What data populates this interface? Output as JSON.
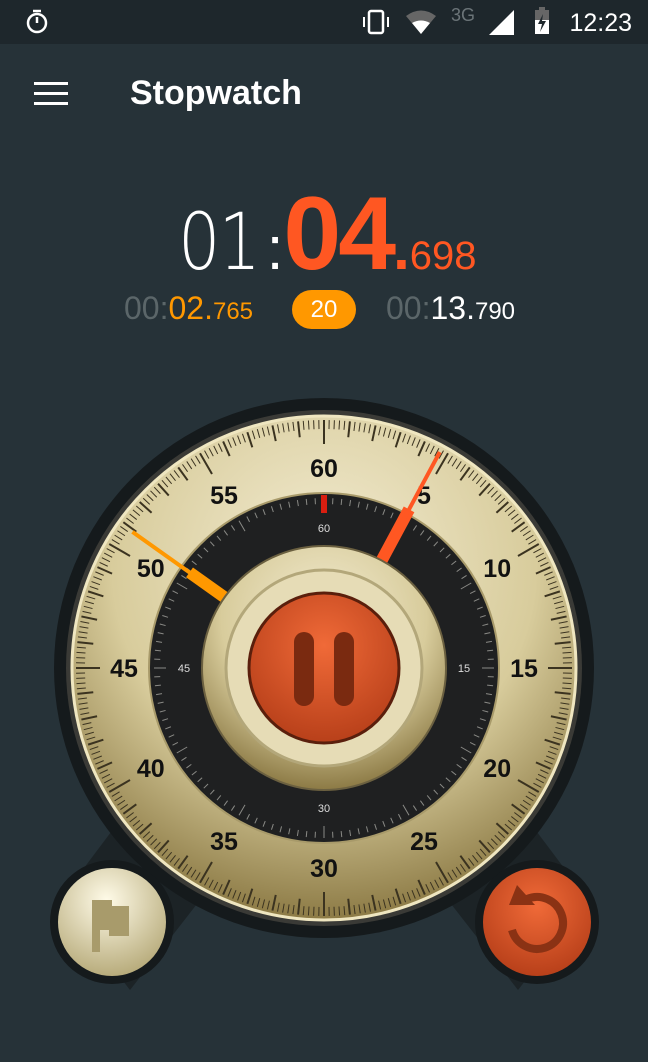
{
  "status_bar": {
    "left_icon": "stopwatch-icon",
    "icons": [
      "vibrate-icon",
      "wifi-icon",
      "signal-icon",
      "battery-charging-icon"
    ],
    "network": "3G",
    "time": "12:23"
  },
  "app_bar": {
    "menu_icon": "hamburger-menu-icon",
    "title": "Stopwatch"
  },
  "main_time": {
    "minutes": "01",
    "colon": ":",
    "seconds": "04",
    "dot": ".",
    "millis": "698"
  },
  "lap_time": {
    "minutes": "00",
    "colon": ":",
    "seconds": "02",
    "dot": ".",
    "millis": "765"
  },
  "lap_count": "20",
  "total_time": {
    "minutes": "00",
    "colon": ":",
    "seconds": "13",
    "dot": ".",
    "millis": "790"
  },
  "dial": {
    "outer_labels": [
      "60",
      "5",
      "10",
      "15",
      "20",
      "25",
      "30",
      "35",
      "40",
      "45",
      "50",
      "55"
    ],
    "inner_labels": [
      "60",
      "15",
      "30",
      "45"
    ],
    "second_hand_value": 4.7,
    "lap_hand_value": 50.9
  },
  "buttons": {
    "pause_icon": "pause-icon",
    "lap_icon": "flag-icon",
    "reset_icon": "reset-icon"
  },
  "colors": {
    "background": "#263238",
    "accent": "#ff5722",
    "lap": "#ff9800",
    "dial_cream": "#d9cfa6"
  }
}
